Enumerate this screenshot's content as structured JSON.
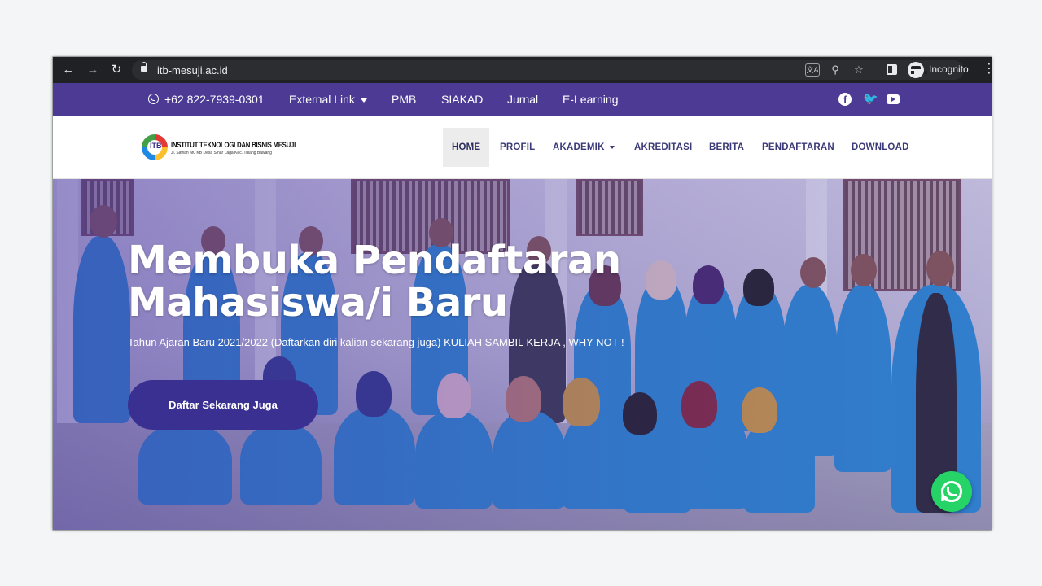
{
  "browser": {
    "url": "itb-mesuji.ac.id",
    "profile_label": "Incognito",
    "icons": [
      "back-arrow-icon",
      "forward-arrow-icon",
      "reload-icon",
      "lock-icon",
      "translate-icon",
      "zoom-icon",
      "star-icon",
      "side-panel-icon",
      "incognito-icon",
      "kebab-menu-icon"
    ]
  },
  "topbar": {
    "phone": "+62 822-7939-0301",
    "links": [
      "External Link",
      "PMB",
      "SIAKAD",
      "Jurnal",
      "E-Learning"
    ],
    "social_icons": [
      "facebook-icon",
      "twitter-icon",
      "youtube-icon"
    ],
    "color": "#4c3a94"
  },
  "header": {
    "logo_title": "INSTITUT TEKNOLOGI DAN BISNIS MESUJI",
    "logo_subtitle": "Jl. Sawan Mu KB Desa Sinar Laga Kec. Tulang Bawang",
    "logo_initials": "ITB",
    "menu": [
      "HOME",
      "PROFIL",
      "AKADEMIK",
      "AKREDITASI",
      "BERITA",
      "PENDAFTARAN",
      "DOWNLOAD"
    ],
    "active_menu": "HOME"
  },
  "hero": {
    "title_line1": "Membuka Pendaftaran",
    "title_line2": "Mahasiswa/i Baru",
    "subtitle": "Tahun Ajaran Baru 2021/2022 (Daftarkan diri kalian sekarang juga) KULIAH SAMBIL KERJA , WHY NOT !",
    "cta_label": "Daftar Sekarang Juga",
    "cta_color": "#3a3091"
  },
  "floating": {
    "whatsapp_icon": "whatsapp-icon",
    "color": "#25d366"
  }
}
